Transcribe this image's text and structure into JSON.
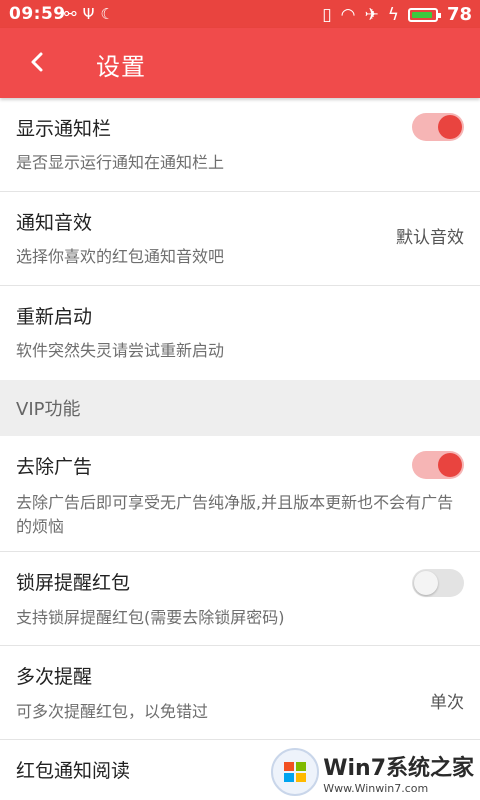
{
  "status_bar": {
    "time": "09:59",
    "battery": "78"
  },
  "appbar": {
    "title": "设置"
  },
  "items": [
    {
      "title": "显示通知栏",
      "subtitle": "是否显示运行通知在通知栏上",
      "toggle": "on"
    },
    {
      "title": "通知音效",
      "subtitle": "选择你喜欢的红包通知音效吧",
      "value": "默认音效"
    },
    {
      "title": "重新启动",
      "subtitle": "软件突然失灵请尝试重新启动"
    }
  ],
  "section": {
    "label": "VIP功能"
  },
  "vip_items": [
    {
      "title": "去除广告",
      "subtitle": "去除广告后即可享受无广告纯净版,并且版本更新也不会有广告的烦恼",
      "toggle": "on"
    },
    {
      "title": "锁屏提醒红包",
      "subtitle": "支持锁屏提醒红包(需要去除锁屏密码)",
      "toggle": "off"
    },
    {
      "title": "多次提醒",
      "subtitle": "可多次提醒红包，以免错过",
      "value": "单次"
    },
    {
      "title": "红包通知阅读"
    }
  ],
  "watermark": {
    "brand": "Win7系统之家",
    "url": "Www.Winwin7.com"
  },
  "colors": {
    "accent": "#e9443f",
    "appbar": "#f04b4b"
  }
}
